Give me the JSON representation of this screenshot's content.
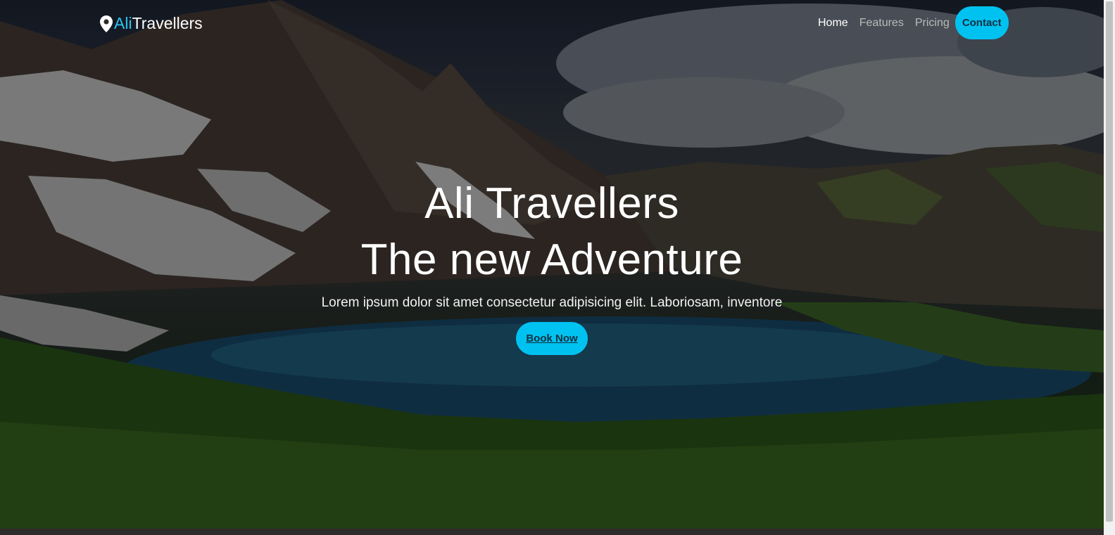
{
  "brand": {
    "prefix": "Ali",
    "suffix": "Travellers",
    "accent_color": "#2bc4f0",
    "icon": "map-pin-icon"
  },
  "nav": {
    "items": [
      {
        "label": "Home",
        "active": true
      },
      {
        "label": "Features",
        "active": false
      },
      {
        "label": "Pricing",
        "active": false
      }
    ],
    "contact_label": "Contact",
    "button_color": "#00c2f0"
  },
  "hero": {
    "title_line1": "Ali Travellers",
    "title_line2": "The new Adventure",
    "subtitle": "Lorem ipsum dolor sit amet consectetur adipisicing elit. Laboriosam, inventore",
    "cta_label": "Book Now"
  }
}
